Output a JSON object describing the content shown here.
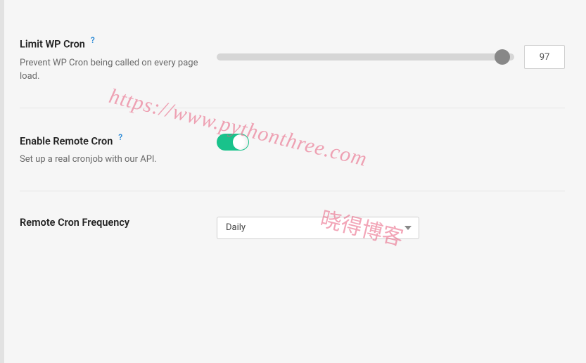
{
  "settings": {
    "limit_wp_cron": {
      "title": "Limit WP Cron",
      "help": "?",
      "description": "Prevent WP Cron being called on every page load.",
      "slider_value": 97,
      "slider_min": 0,
      "slider_max": 100
    },
    "enable_remote_cron": {
      "title": "Enable Remote Cron",
      "help": "?",
      "description": "Set up a real cronjob with our API.",
      "enabled": true
    },
    "remote_cron_frequency": {
      "title": "Remote Cron Frequency",
      "selected": "Daily"
    }
  },
  "watermark": {
    "url": "https://www.pythonthree.com",
    "text_cn": "晓得博客"
  },
  "colors": {
    "accent_toggle": "#19c28b",
    "help_link": "#2a89d6"
  }
}
